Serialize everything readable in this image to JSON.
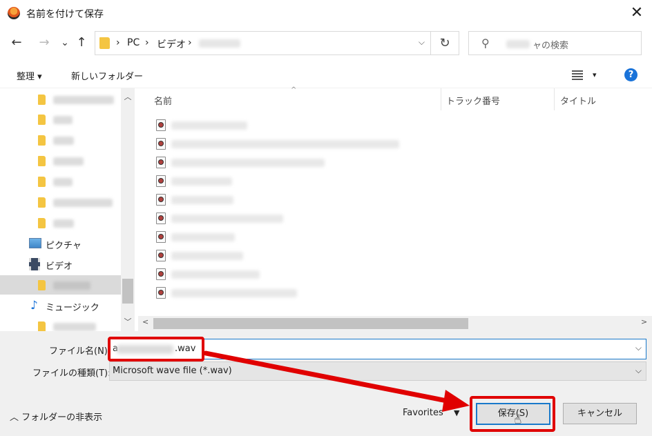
{
  "window": {
    "title": "名前を付けて保存",
    "close_glyph": "✕"
  },
  "nav": {
    "back_glyph": "←",
    "forward_glyph": "→",
    "recent_glyph": "⌄",
    "up_glyph": "↑",
    "breadcrumb": [
      "PC",
      "ビデオ"
    ],
    "sep": "›",
    "refresh_glyph": "↻",
    "search_placeholder": "ャの検索"
  },
  "toolbar": {
    "organize": "整理 ▾",
    "new_folder": "新しいフォルダー",
    "view_dd": "▾",
    "help": "?"
  },
  "tree": {
    "items": [
      {
        "label": "ピクチャ",
        "icon": "pictures-icon"
      },
      {
        "label": "ビデオ",
        "icon": "video-icon"
      },
      {
        "label": "ミュージック",
        "icon": "music-icon"
      }
    ]
  },
  "columns": {
    "name": "名前",
    "track": "トラック番号",
    "title": "タイトル",
    "sort_glyph": "^"
  },
  "form": {
    "filename_label": "ファイル名(N):",
    "filename_prefix": "a",
    "filename_ext": ".wav",
    "filetype_label": "ファイルの種類(T):",
    "filetype_value": "Microsoft wave file (*.wav)",
    "dd_glyph": "⌵"
  },
  "footer": {
    "hide_folders": "︿ フォルダーの非表示",
    "favorites": "Favorites",
    "favorites_dd": "▼",
    "save": "保存(S)",
    "cancel": "キャンセル"
  },
  "colors": {
    "accent": "#1979ca",
    "annotation": "#e00000",
    "folder": "#f4c542"
  }
}
